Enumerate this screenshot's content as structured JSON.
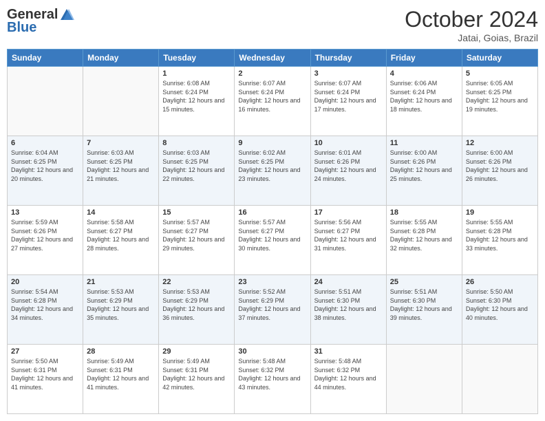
{
  "logo": {
    "general": "General",
    "blue": "Blue"
  },
  "header": {
    "month": "October 2024",
    "location": "Jatai, Goias, Brazil"
  },
  "weekdays": [
    "Sunday",
    "Monday",
    "Tuesday",
    "Wednesday",
    "Thursday",
    "Friday",
    "Saturday"
  ],
  "weeks": [
    [
      {
        "day": "",
        "info": ""
      },
      {
        "day": "",
        "info": ""
      },
      {
        "day": "1",
        "info": "Sunrise: 6:08 AM\nSunset: 6:24 PM\nDaylight: 12 hours and 15 minutes."
      },
      {
        "day": "2",
        "info": "Sunrise: 6:07 AM\nSunset: 6:24 PM\nDaylight: 12 hours and 16 minutes."
      },
      {
        "day": "3",
        "info": "Sunrise: 6:07 AM\nSunset: 6:24 PM\nDaylight: 12 hours and 17 minutes."
      },
      {
        "day": "4",
        "info": "Sunrise: 6:06 AM\nSunset: 6:24 PM\nDaylight: 12 hours and 18 minutes."
      },
      {
        "day": "5",
        "info": "Sunrise: 6:05 AM\nSunset: 6:25 PM\nDaylight: 12 hours and 19 minutes."
      }
    ],
    [
      {
        "day": "6",
        "info": "Sunrise: 6:04 AM\nSunset: 6:25 PM\nDaylight: 12 hours and 20 minutes."
      },
      {
        "day": "7",
        "info": "Sunrise: 6:03 AM\nSunset: 6:25 PM\nDaylight: 12 hours and 21 minutes."
      },
      {
        "day": "8",
        "info": "Sunrise: 6:03 AM\nSunset: 6:25 PM\nDaylight: 12 hours and 22 minutes."
      },
      {
        "day": "9",
        "info": "Sunrise: 6:02 AM\nSunset: 6:25 PM\nDaylight: 12 hours and 23 minutes."
      },
      {
        "day": "10",
        "info": "Sunrise: 6:01 AM\nSunset: 6:26 PM\nDaylight: 12 hours and 24 minutes."
      },
      {
        "day": "11",
        "info": "Sunrise: 6:00 AM\nSunset: 6:26 PM\nDaylight: 12 hours and 25 minutes."
      },
      {
        "day": "12",
        "info": "Sunrise: 6:00 AM\nSunset: 6:26 PM\nDaylight: 12 hours and 26 minutes."
      }
    ],
    [
      {
        "day": "13",
        "info": "Sunrise: 5:59 AM\nSunset: 6:26 PM\nDaylight: 12 hours and 27 minutes."
      },
      {
        "day": "14",
        "info": "Sunrise: 5:58 AM\nSunset: 6:27 PM\nDaylight: 12 hours and 28 minutes."
      },
      {
        "day": "15",
        "info": "Sunrise: 5:57 AM\nSunset: 6:27 PM\nDaylight: 12 hours and 29 minutes."
      },
      {
        "day": "16",
        "info": "Sunrise: 5:57 AM\nSunset: 6:27 PM\nDaylight: 12 hours and 30 minutes."
      },
      {
        "day": "17",
        "info": "Sunrise: 5:56 AM\nSunset: 6:27 PM\nDaylight: 12 hours and 31 minutes."
      },
      {
        "day": "18",
        "info": "Sunrise: 5:55 AM\nSunset: 6:28 PM\nDaylight: 12 hours and 32 minutes."
      },
      {
        "day": "19",
        "info": "Sunrise: 5:55 AM\nSunset: 6:28 PM\nDaylight: 12 hours and 33 minutes."
      }
    ],
    [
      {
        "day": "20",
        "info": "Sunrise: 5:54 AM\nSunset: 6:28 PM\nDaylight: 12 hours and 34 minutes."
      },
      {
        "day": "21",
        "info": "Sunrise: 5:53 AM\nSunset: 6:29 PM\nDaylight: 12 hours and 35 minutes."
      },
      {
        "day": "22",
        "info": "Sunrise: 5:53 AM\nSunset: 6:29 PM\nDaylight: 12 hours and 36 minutes."
      },
      {
        "day": "23",
        "info": "Sunrise: 5:52 AM\nSunset: 6:29 PM\nDaylight: 12 hours and 37 minutes."
      },
      {
        "day": "24",
        "info": "Sunrise: 5:51 AM\nSunset: 6:30 PM\nDaylight: 12 hours and 38 minutes."
      },
      {
        "day": "25",
        "info": "Sunrise: 5:51 AM\nSunset: 6:30 PM\nDaylight: 12 hours and 39 minutes."
      },
      {
        "day": "26",
        "info": "Sunrise: 5:50 AM\nSunset: 6:30 PM\nDaylight: 12 hours and 40 minutes."
      }
    ],
    [
      {
        "day": "27",
        "info": "Sunrise: 5:50 AM\nSunset: 6:31 PM\nDaylight: 12 hours and 41 minutes."
      },
      {
        "day": "28",
        "info": "Sunrise: 5:49 AM\nSunset: 6:31 PM\nDaylight: 12 hours and 41 minutes."
      },
      {
        "day": "29",
        "info": "Sunrise: 5:49 AM\nSunset: 6:31 PM\nDaylight: 12 hours and 42 minutes."
      },
      {
        "day": "30",
        "info": "Sunrise: 5:48 AM\nSunset: 6:32 PM\nDaylight: 12 hours and 43 minutes."
      },
      {
        "day": "31",
        "info": "Sunrise: 5:48 AM\nSunset: 6:32 PM\nDaylight: 12 hours and 44 minutes."
      },
      {
        "day": "",
        "info": ""
      },
      {
        "day": "",
        "info": ""
      }
    ]
  ]
}
